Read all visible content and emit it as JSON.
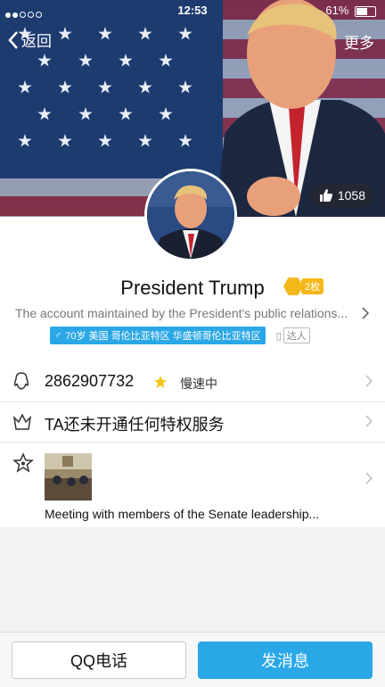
{
  "status_bar": {
    "time": "12:53",
    "battery": "61%",
    "battery_level": 0.61
  },
  "nav": {
    "back_label": "返回",
    "more_label": "更多"
  },
  "cover": {
    "likes": "1058"
  },
  "profile": {
    "name": "President Trump",
    "badge_count": "2枚",
    "bio": "The account maintained by the President's public relations...",
    "tag": "70岁 美国 哥伦比亚特区 华盛顿哥伦比亚特区",
    "daren": "达人"
  },
  "list": {
    "qq_number": "2862907732",
    "speed_text": "慢速中",
    "privilege_text": "TA还未开通任何特权服务",
    "album_caption": "Meeting with members of the Senate leadership..."
  },
  "bottom": {
    "call_label": "QQ电话",
    "message_label": "发消息"
  },
  "colors": {
    "accent": "#2aa7e6",
    "badge": "#f5b81b"
  }
}
